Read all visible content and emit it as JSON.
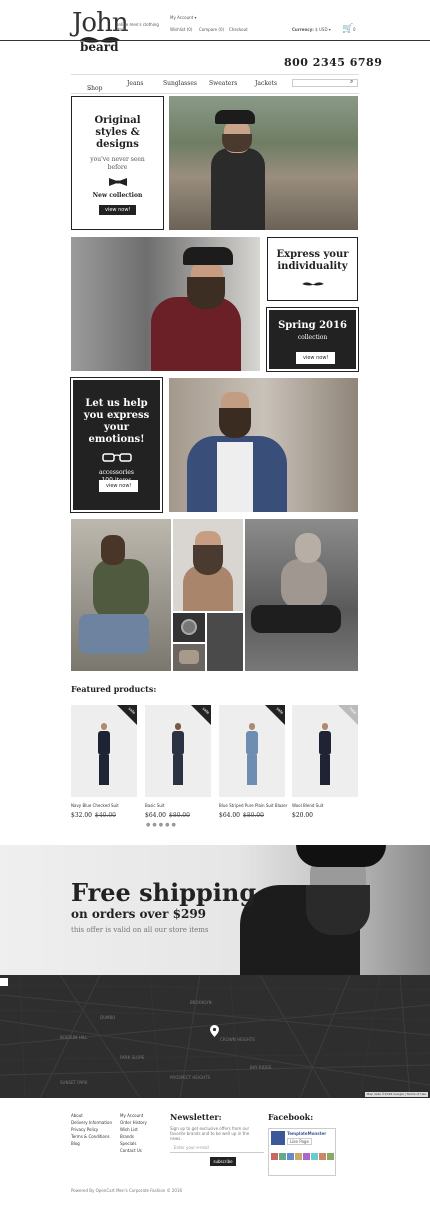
{
  "header": {
    "logo_top": "John",
    "logo_bottom": "beard",
    "tagline": "online men's clothing store",
    "account": "My Account",
    "wishlist": "Wishlist (0)",
    "compare": "Compare (0)",
    "checkout": "Checkout",
    "currency_label": "Currency:",
    "currency_value": "$ USD",
    "cart_count": "0",
    "phone": "800 2345 6789"
  },
  "nav": {
    "items": [
      "Shop",
      "Jeans",
      "Sunglasses",
      "Sweaters",
      "Jackets"
    ]
  },
  "promo1": {
    "title": "Original styles & designs",
    "subtitle": "you've never seen before",
    "label": "New collection",
    "button": "view now!"
  },
  "promo2": {
    "title": "Express your individuality"
  },
  "promo3": {
    "title": "Spring 2016",
    "label": "collection",
    "button": "view now!"
  },
  "promo4": {
    "title": "Let us help you express your emotions!",
    "label": "accessories",
    "count": "100 items",
    "button": "view now!"
  },
  "featured": {
    "heading": "Featured products:",
    "products": [
      {
        "name": "Navy Blue Checked Suit",
        "price": "$32.00",
        "old": "$40.00",
        "badge": "sale",
        "color": "#1e2433"
      },
      {
        "name": "Basic Suit",
        "price": "$64.00",
        "old": "$80.00",
        "badge": "sale",
        "color": "#2b3242"
      },
      {
        "name": "Blue Striped Pure Plain Suit Blazer",
        "price": "$64.00",
        "old": "$80.00",
        "badge": "sale",
        "color": "#6f8db1"
      },
      {
        "name": "Wool Blend Suit",
        "price": "$20.00",
        "old": "",
        "badge": "new",
        "color": "#1f2333"
      }
    ]
  },
  "shipping": {
    "title": "Free shipping",
    "subtitle": "on orders over $299",
    "note": "this offer is valid on all our store items"
  },
  "map": {
    "labels": [
      "BROOKLYN",
      "DUMBO",
      "BOERUM HILL",
      "PARK SLOPE",
      "CROWN HEIGHTS",
      "PROSPECT HEIGHTS",
      "BAY RIDGE",
      "SUNSET PARK"
    ],
    "attribution": "Map data ©2016 Google | Terms of Use"
  },
  "footer": {
    "col1": [
      "About",
      "Delivery Information",
      "Privacy Policy",
      "Terms & Conditions",
      "Blog"
    ],
    "col2": [
      "My Account",
      "Order History",
      "Wish List",
      "Brands",
      "Specials",
      "Contact Us"
    ],
    "newsletter_title": "Newsletter:",
    "newsletter_text": "Sign up to get exclusive offers from our favorite brands and to be well up in the news.",
    "email_placeholder": "Enter your e-mail",
    "subscribe": "subscribe",
    "facebook_title": "Facebook:",
    "fb_page": "TemplateMonster",
    "fb_like": "Like Page",
    "copyright": "Powered By OpenCart Men's Corporate Fashion © 2016"
  }
}
